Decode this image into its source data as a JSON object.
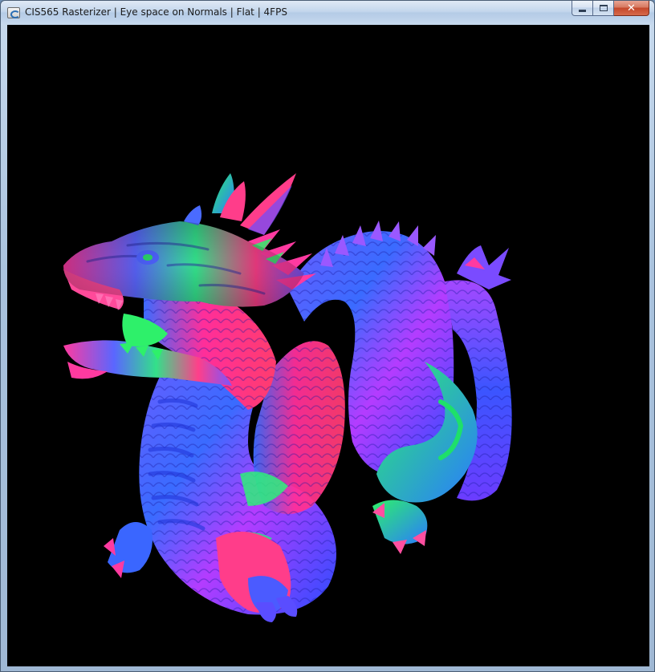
{
  "window": {
    "title": "CIS565 Rasterizer | Eye space on Normals | Flat | 4FPS",
    "app_icon": "application-icon",
    "controls": {
      "minimize_icon": "minimize-icon",
      "maximize_icon": "maximize-icon",
      "close_icon": "close-icon",
      "close_glyph": "✕"
    },
    "titlebar_color": "#c3d6ec",
    "close_color": "#c4472a"
  },
  "viewport": {
    "background_color": "#000000",
    "render_subject": "dragon-model"
  }
}
